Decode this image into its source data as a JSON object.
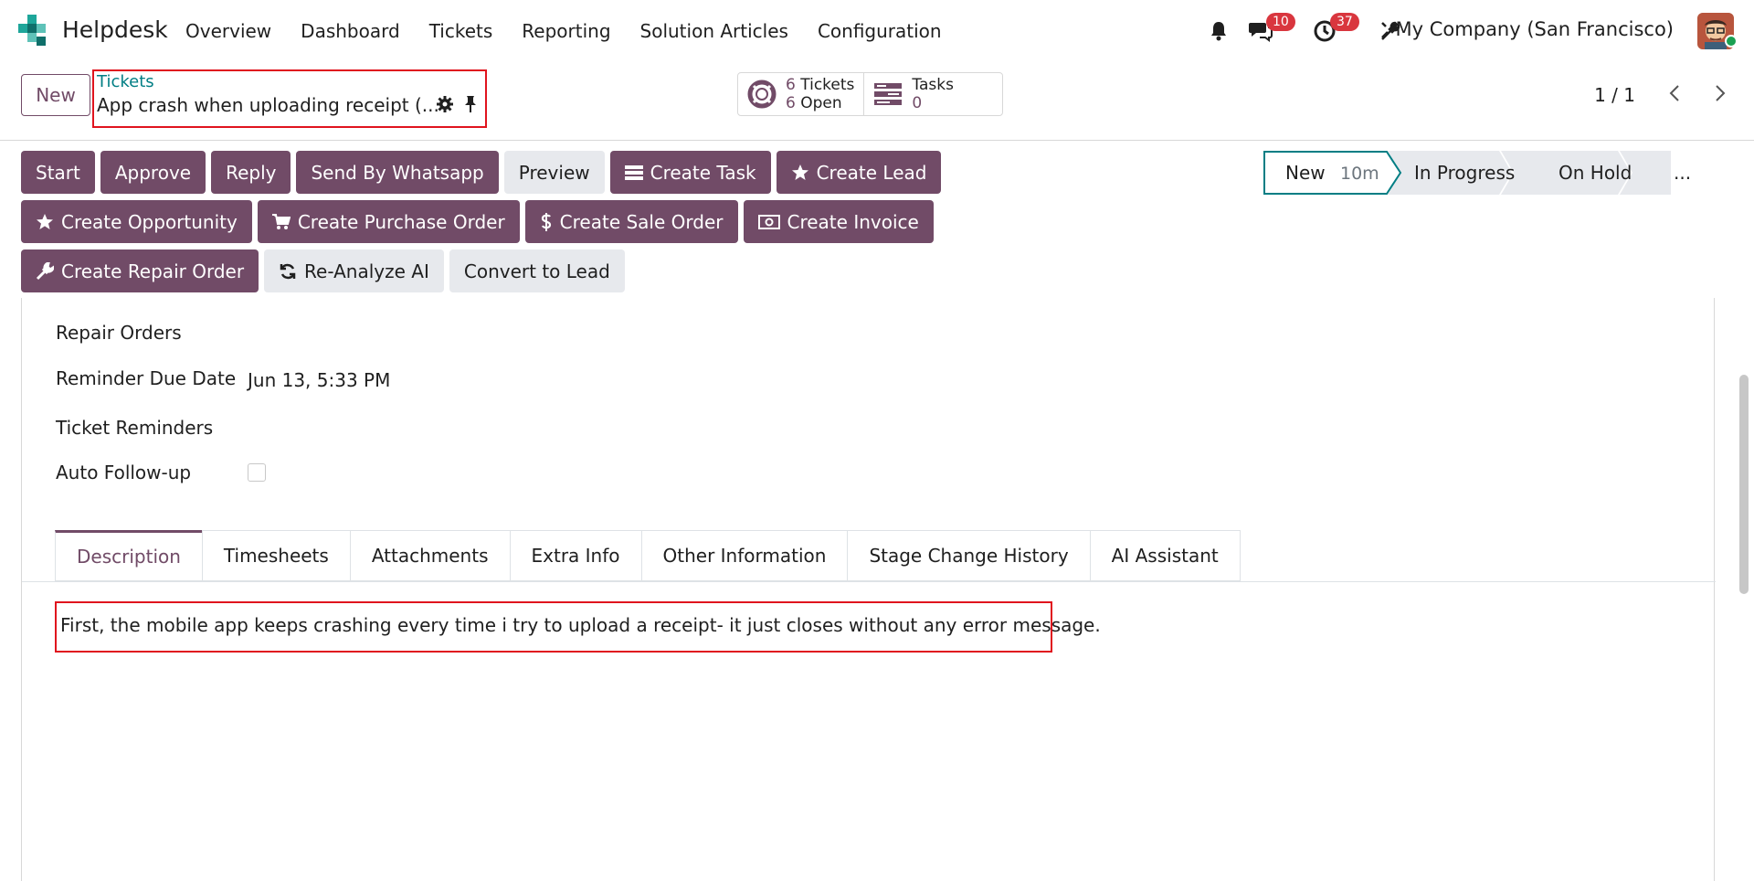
{
  "app": {
    "name": "Helpdesk"
  },
  "nav": {
    "items": [
      "Overview",
      "Dashboard",
      "Tickets",
      "Reporting",
      "Solution Articles",
      "Configuration"
    ],
    "messages_count": "10",
    "activities_count": "37",
    "company": "My Company (San Francisco)"
  },
  "control": {
    "new_label": "New",
    "breadcrumb_parent": "Tickets",
    "breadcrumb_title": "App crash when uploading receipt (...",
    "smart_tickets_line1_num": "6",
    "smart_tickets_line1_text": "Tickets",
    "smart_tickets_line2_num": "6",
    "smart_tickets_line2_text": "Open",
    "smart_tasks_label": "Tasks",
    "smart_tasks_count": "0",
    "pager": "1 / 1"
  },
  "actions": {
    "row1": [
      {
        "label": "Start",
        "style": "primary",
        "icon": ""
      },
      {
        "label": "Approve",
        "style": "primary",
        "icon": ""
      },
      {
        "label": "Reply",
        "style": "primary",
        "icon": ""
      },
      {
        "label": "Send By Whatsapp",
        "style": "primary",
        "icon": ""
      },
      {
        "label": "Preview",
        "style": "secondary",
        "icon": ""
      },
      {
        "label": "Create Task",
        "style": "primary",
        "icon": "tasks-icon"
      },
      {
        "label": "Create Lead",
        "style": "primary",
        "icon": "star-icon"
      }
    ],
    "row2": [
      {
        "label": "Create Opportunity",
        "style": "primary",
        "icon": "star-icon"
      },
      {
        "label": "Create Purchase Order",
        "style": "primary",
        "icon": "cart-icon"
      },
      {
        "label": "Create Sale Order",
        "style": "primary",
        "icon": "dollar-icon"
      },
      {
        "label": "Create Invoice",
        "style": "primary",
        "icon": "money-icon"
      }
    ],
    "row3": [
      {
        "label": "Create Repair Order",
        "style": "primary",
        "icon": "wrench-icon"
      },
      {
        "label": "Re-Analyze AI",
        "style": "secondary",
        "icon": "refresh-icon"
      },
      {
        "label": "Convert to Lead",
        "style": "secondary",
        "icon": ""
      }
    ]
  },
  "status": {
    "stages": [
      "New",
      "In Progress",
      "On Hold",
      "..."
    ],
    "current_stage": "New",
    "current_duration": "10m"
  },
  "form": {
    "repair_orders_label": "Repair Orders",
    "reminder_due_label": "Reminder Due Date",
    "reminder_due_value": "Jun 13, 5:33 PM",
    "ticket_reminders_label": "Ticket Reminders",
    "auto_followup_label": "Auto Follow-up",
    "auto_followup_checked": false
  },
  "tabs": [
    "Description",
    "Timesheets",
    "Attachments",
    "Extra Info",
    "Other Information",
    "Stage Change History",
    "AI Assistant"
  ],
  "active_tab": "Description",
  "description": "First, the mobile app keeps crashing every time i try to upload a receipt- it just closes without any error message.",
  "colors": {
    "primary": "#714b67",
    "teal": "#017e84",
    "badge": "#d9363e",
    "highlight": "#e0141e"
  }
}
